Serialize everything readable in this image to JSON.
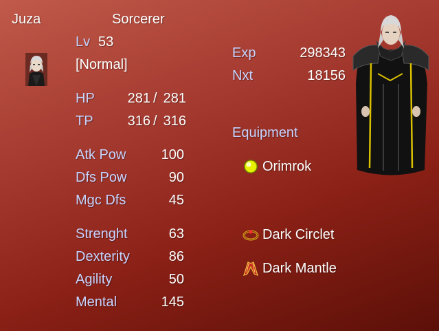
{
  "character": {
    "name": "Juza",
    "class": "Sorcerer",
    "level_label": "Lv",
    "level": "53",
    "state": "[Normal]"
  },
  "vitals": {
    "hp_label": "HP",
    "hp_current": "281",
    "hp_max": "281",
    "tp_label": "TP",
    "tp_current": "316",
    "tp_max": "316",
    "separator": "/"
  },
  "params": [
    {
      "label": "Atk Pow",
      "value": "100"
    },
    {
      "label": "Dfs Pow",
      "value": "90"
    },
    {
      "label": "Mgc Dfs",
      "value": "45"
    }
  ],
  "attributes": [
    {
      "label": "Strenght",
      "value": "63"
    },
    {
      "label": "Dexterity",
      "value": "86"
    },
    {
      "label": "Agility",
      "value": "50"
    },
    {
      "label": "Mental",
      "value": "145"
    }
  ],
  "experience": {
    "exp_label": "Exp",
    "exp_value": "298343",
    "next_label": "Nxt",
    "next_value": "18156"
  },
  "equipment": {
    "heading": "Equipment",
    "items": [
      {
        "name": "Orimrok",
        "icon": "orb-icon"
      },
      {
        "name": "Dark Circlet",
        "icon": "circlet-icon"
      },
      {
        "name": "Dark Mantle",
        "icon": "mantle-icon"
      }
    ]
  },
  "colors": {
    "label_blue": "#c8d4ff",
    "text_white": "#ffffff",
    "background_red": "#a53a30"
  }
}
